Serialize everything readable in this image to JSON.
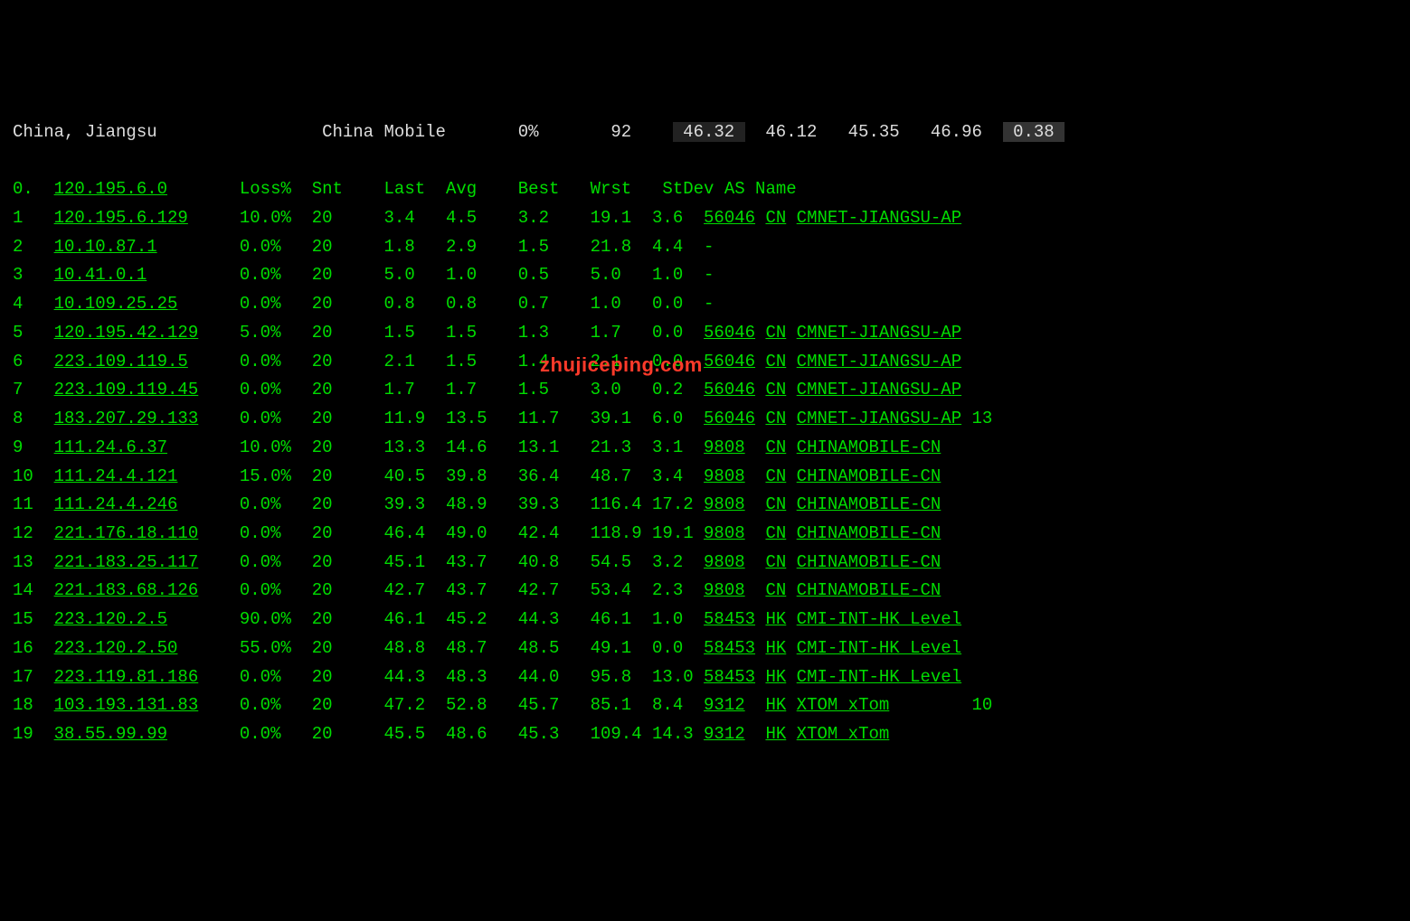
{
  "header": {
    "location": "China, Jiangsu",
    "provider": "China Mobile",
    "pct": "0%",
    "count": "92",
    "v1": "46.32",
    "v2": "46.12",
    "v3": "45.35",
    "v4": "46.96",
    "v5": "0.38"
  },
  "columns": {
    "loss": "Loss%",
    "snt": "Snt",
    "last": "Last",
    "avg": "Avg",
    "best": "Best",
    "wrst": "Wrst",
    "stdev": "StDev",
    "asname": "AS Name"
  },
  "title_hop": {
    "idx": "0.",
    "ip": "120.195.6.0"
  },
  "hops": [
    {
      "idx": "1",
      "ip": "120.195.6.129",
      "loss": "10.0%",
      "snt": "20",
      "last": "3.4",
      "avg": "4.5",
      "best": "3.2",
      "wrst": "19.1",
      "stdev": "3.6",
      "asn": "56046",
      "cc": "CN",
      "asname": "CMNET-JIANGSU-AP",
      "extra": ""
    },
    {
      "idx": "2",
      "ip": "10.10.87.1",
      "loss": "0.0%",
      "snt": "20",
      "last": "1.8",
      "avg": "2.9",
      "best": "1.5",
      "wrst": "21.8",
      "stdev": "4.4",
      "asn": "-",
      "cc": "",
      "asname": "",
      "extra": ""
    },
    {
      "idx": "3",
      "ip": "10.41.0.1",
      "loss": "0.0%",
      "snt": "20",
      "last": "5.0",
      "avg": "1.0",
      "best": "0.5",
      "wrst": "5.0",
      "stdev": "1.0",
      "asn": "-",
      "cc": "",
      "asname": "",
      "extra": ""
    },
    {
      "idx": "4",
      "ip": "10.109.25.25",
      "loss": "0.0%",
      "snt": "20",
      "last": "0.8",
      "avg": "0.8",
      "best": "0.7",
      "wrst": "1.0",
      "stdev": "0.0",
      "asn": "-",
      "cc": "",
      "asname": "",
      "extra": ""
    },
    {
      "idx": "5",
      "ip": "120.195.42.129",
      "loss": "5.0%",
      "snt": "20",
      "last": "1.5",
      "avg": "1.5",
      "best": "1.3",
      "wrst": "1.7",
      "stdev": "0.0",
      "asn": "56046",
      "cc": "CN",
      "asname": "CMNET-JIANGSU-AP",
      "extra": ""
    },
    {
      "idx": "6",
      "ip": "223.109.119.5",
      "loss": "0.0%",
      "snt": "20",
      "last": "2.1",
      "avg": "1.5",
      "best": "1.4",
      "wrst": "2.1",
      "stdev": "0.0",
      "asn": "56046",
      "cc": "CN",
      "asname": "CMNET-JIANGSU-AP",
      "extra": ""
    },
    {
      "idx": "7",
      "ip": "223.109.119.45",
      "loss": "0.0%",
      "snt": "20",
      "last": "1.7",
      "avg": "1.7",
      "best": "1.5",
      "wrst": "3.0",
      "stdev": "0.2",
      "asn": "56046",
      "cc": "CN",
      "asname": "CMNET-JIANGSU-AP",
      "extra": ""
    },
    {
      "idx": "8",
      "ip": "183.207.29.133",
      "loss": "0.0%",
      "snt": "20",
      "last": "11.9",
      "avg": "13.5",
      "best": "11.7",
      "wrst": "39.1",
      "stdev": "6.0",
      "asn": "56046",
      "cc": "CN",
      "asname": "CMNET-JIANGSU-AP",
      "extra": " 13"
    },
    {
      "idx": "9",
      "ip": "111.24.6.37",
      "loss": "10.0%",
      "snt": "20",
      "last": "13.3",
      "avg": "14.6",
      "best": "13.1",
      "wrst": "21.3",
      "stdev": "3.1",
      "asn": "9808",
      "cc": "CN",
      "asname": "CHINAMOBILE-CN",
      "extra": ""
    },
    {
      "idx": "10",
      "ip": "111.24.4.121",
      "loss": "15.0%",
      "snt": "20",
      "last": "40.5",
      "avg": "39.8",
      "best": "36.4",
      "wrst": "48.7",
      "stdev": "3.4",
      "asn": "9808",
      "cc": "CN",
      "asname": "CHINAMOBILE-CN",
      "extra": ""
    },
    {
      "idx": "11",
      "ip": "111.24.4.246",
      "loss": "0.0%",
      "snt": "20",
      "last": "39.3",
      "avg": "48.9",
      "best": "39.3",
      "wrst": "116.4",
      "stdev": "17.2",
      "asn": "9808",
      "cc": "CN",
      "asname": "CHINAMOBILE-CN",
      "extra": ""
    },
    {
      "idx": "12",
      "ip": "221.176.18.110",
      "loss": "0.0%",
      "snt": "20",
      "last": "46.4",
      "avg": "49.0",
      "best": "42.4",
      "wrst": "118.9",
      "stdev": "19.1",
      "asn": "9808",
      "cc": "CN",
      "asname": "CHINAMOBILE-CN",
      "extra": ""
    },
    {
      "idx": "13",
      "ip": "221.183.25.117",
      "loss": "0.0%",
      "snt": "20",
      "last": "45.1",
      "avg": "43.7",
      "best": "40.8",
      "wrst": "54.5",
      "stdev": "3.2",
      "asn": "9808",
      "cc": "CN",
      "asname": "CHINAMOBILE-CN",
      "extra": ""
    },
    {
      "idx": "14",
      "ip": "221.183.68.126",
      "loss": "0.0%",
      "snt": "20",
      "last": "42.7",
      "avg": "43.7",
      "best": "42.7",
      "wrst": "53.4",
      "stdev": "2.3",
      "asn": "9808",
      "cc": "CN",
      "asname": "CHINAMOBILE-CN",
      "extra": ""
    },
    {
      "idx": "15",
      "ip": "223.120.2.5",
      "loss": "90.0%",
      "snt": "20",
      "last": "46.1",
      "avg": "45.2",
      "best": "44.3",
      "wrst": "46.1",
      "stdev": "1.0",
      "asn": "58453",
      "cc": "HK",
      "asname": "CMI-INT-HK Level",
      "extra": ""
    },
    {
      "idx": "16",
      "ip": "223.120.2.50",
      "loss": "55.0%",
      "snt": "20",
      "last": "48.8",
      "avg": "48.7",
      "best": "48.5",
      "wrst": "49.1",
      "stdev": "0.0",
      "asn": "58453",
      "cc": "HK",
      "asname": "CMI-INT-HK Level",
      "extra": ""
    },
    {
      "idx": "17",
      "ip": "223.119.81.186",
      "loss": "0.0%",
      "snt": "20",
      "last": "44.3",
      "avg": "48.3",
      "best": "44.0",
      "wrst": "95.8",
      "stdev": "13.0",
      "asn": "58453",
      "cc": "HK",
      "asname": "CMI-INT-HK Level",
      "extra": ""
    },
    {
      "idx": "18",
      "ip": "103.193.131.83",
      "loss": "0.0%",
      "snt": "20",
      "last": "47.2",
      "avg": "52.8",
      "best": "45.7",
      "wrst": "85.1",
      "stdev": "8.4",
      "asn": "9312",
      "cc": "HK",
      "asname": "XTOM xTom",
      "extra": "        10"
    },
    {
      "idx": "19",
      "ip": "38.55.99.99",
      "loss": "0.0%",
      "snt": "20",
      "last": "45.5",
      "avg": "48.6",
      "best": "45.3",
      "wrst": "109.4",
      "stdev": "14.3",
      "asn": "9312",
      "cc": "HK",
      "asname": "XTOM xTom",
      "extra": ""
    }
  ],
  "watermark": "zhujiceping.com"
}
